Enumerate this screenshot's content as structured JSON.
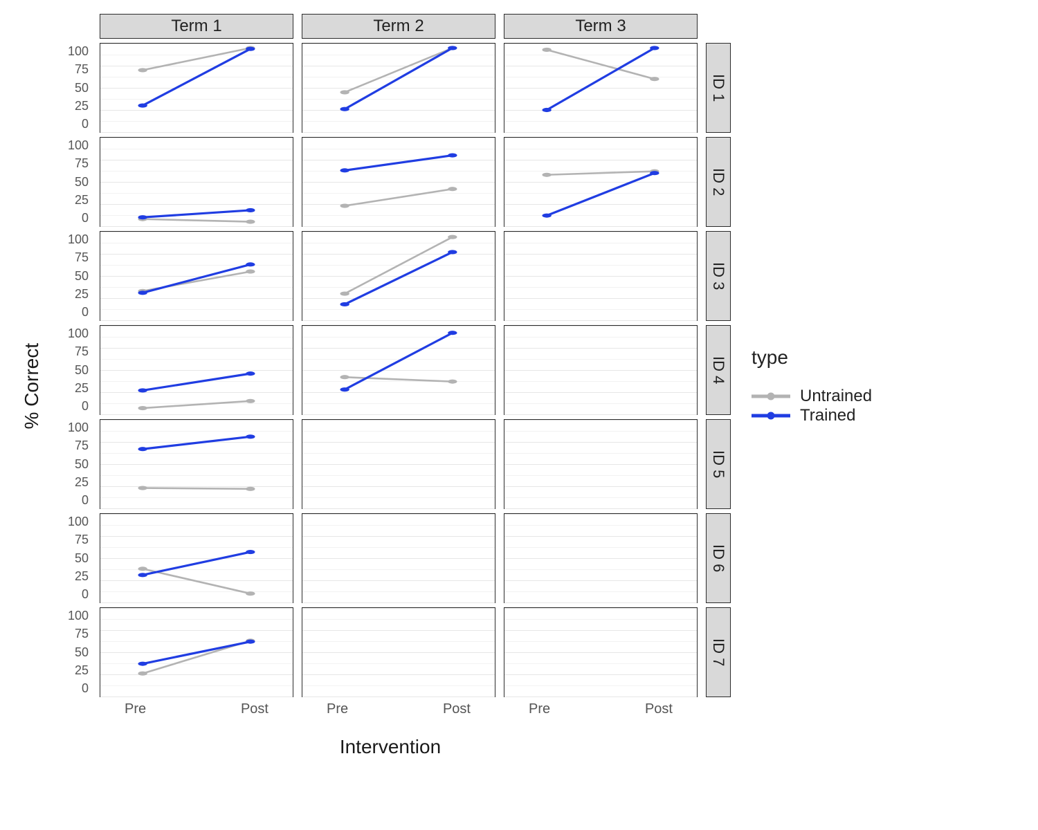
{
  "chart_data": {
    "type": "line",
    "facet_cols": [
      "Term 1",
      "Term 2",
      "Term 3"
    ],
    "facet_rows": [
      "ID 1",
      "ID 2",
      "ID 3",
      "ID 4",
      "ID 5",
      "ID 6",
      "ID 7"
    ],
    "xlabel": "Intervention",
    "ylabel": "% Correct",
    "x_categories": [
      "Pre",
      "Post"
    ],
    "ylim": [
      0,
      100
    ],
    "y_ticks": [
      0,
      25,
      50,
      75,
      100
    ],
    "legend_title": "type",
    "series_meta": [
      {
        "name": "Untrained",
        "color": "#b3b3b3"
      },
      {
        "name": "Trained",
        "color": "#203de2"
      }
    ],
    "panels": [
      [
        {
          "Untrained": [
            70,
            95
          ],
          "Trained": [
            30,
            94
          ]
        },
        {
          "Untrained": [
            45,
            95
          ],
          "Trained": [
            26,
            95
          ]
        },
        {
          "Untrained": [
            93,
            60
          ],
          "Trained": [
            25,
            95
          ]
        }
      ],
      [
        {
          "Untrained": [
            8,
            5
          ],
          "Trained": [
            10,
            18
          ]
        },
        {
          "Untrained": [
            23,
            42
          ],
          "Trained": [
            63,
            80
          ]
        },
        {
          "Untrained": [
            58,
            62
          ],
          "Trained": [
            12,
            60
          ]
        }
      ],
      [
        {
          "Untrained": [
            33,
            55
          ],
          "Trained": [
            31,
            63
          ]
        },
        {
          "Untrained": [
            30,
            94
          ],
          "Trained": [
            18,
            77
          ]
        },
        null
      ],
      [
        {
          "Untrained": [
            7,
            15
          ],
          "Trained": [
            27,
            46
          ]
        },
        {
          "Untrained": [
            42,
            37
          ],
          "Trained": [
            28,
            92
          ]
        },
        null
      ],
      [
        {
          "Untrained": [
            23,
            22
          ],
          "Trained": [
            67,
            81
          ]
        },
        null,
        null
      ],
      [
        {
          "Untrained": [
            38,
            10
          ],
          "Trained": [
            31,
            57
          ]
        },
        null,
        null
      ],
      [
        {
          "Untrained": [
            26,
            63
          ],
          "Trained": [
            37,
            62
          ]
        },
        null,
        null
      ]
    ]
  }
}
